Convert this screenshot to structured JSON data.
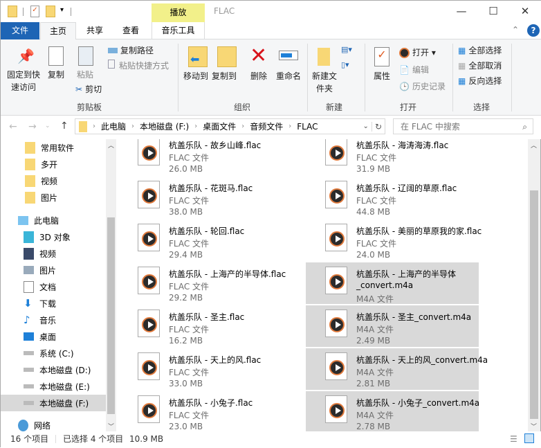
{
  "window": {
    "title": "FLAC",
    "context_tab": "播放",
    "minimize": "—",
    "maximize": "☐",
    "close": "✕"
  },
  "tabs": {
    "file": "文件",
    "home": "主页",
    "share": "共享",
    "view": "查看",
    "music_tools": "音乐工具"
  },
  "ribbon": {
    "pin": "固定到快速访问",
    "copy": "复制",
    "paste": "粘贴",
    "copy_path": "复制路径",
    "paste_shortcut": "粘贴快捷方式",
    "cut": "剪切",
    "clipboard_group": "剪贴板",
    "move_to": "移动到",
    "copy_to": "复制到",
    "delete": "删除",
    "rename": "重命名",
    "organize_group": "组织",
    "new_folder": "新建文件夹",
    "new_group": "新建",
    "properties": "属性",
    "open": "打开",
    "edit": "编辑",
    "history": "历史记录",
    "open_group": "打开",
    "select_all": "全部选择",
    "select_none": "全部取消",
    "invert": "反向选择",
    "select_group": "选择"
  },
  "address": {
    "crumbs": [
      "此电脑",
      "本地磁盘 (F:)",
      "桌面文件",
      "音频文件",
      "FLAC"
    ],
    "search_placeholder": "在 FLAC 中搜索"
  },
  "sidebar": {
    "items": [
      "常用软件",
      "多开",
      "视频",
      "图片",
      "此电脑",
      "3D 对象",
      "视频",
      "图片",
      "文档",
      "下载",
      "音乐",
      "桌面",
      "系统 (C:)",
      "本地磁盘 (D:)",
      "本地磁盘 (E:)",
      "本地磁盘 (F:)",
      "网络"
    ]
  },
  "files": [
    {
      "name": "杭盖乐队 - 故乡山峰.flac",
      "type": "FLAC 文件",
      "size": "26.0 MB",
      "selected": false
    },
    {
      "name": "杭盖乐队 - 海涛海涛.flac",
      "type": "FLAC 文件",
      "size": "31.9 MB",
      "selected": false
    },
    {
      "name": "杭盖乐队 - 花斑马.flac",
      "type": "FLAC 文件",
      "size": "38.0 MB",
      "selected": false
    },
    {
      "name": "杭盖乐队 - 辽阔的草原.flac",
      "type": "FLAC 文件",
      "size": "44.8 MB",
      "selected": false
    },
    {
      "name": "杭盖乐队 - 轮回.flac",
      "type": "FLAC 文件",
      "size": "29.4 MB",
      "selected": false
    },
    {
      "name": "杭盖乐队 - 美丽的草原我的家.flac",
      "type": "FLAC 文件",
      "size": "24.0 MB",
      "selected": false
    },
    {
      "name": "杭盖乐队 - 上海产的半导体.flac",
      "type": "FLAC 文件",
      "size": "29.2 MB",
      "selected": false
    },
    {
      "name": "杭盖乐队 - 上海产的半导体",
      "name2": "_convert.m4a",
      "type": "M4A 文件",
      "selected": true
    },
    {
      "name": "杭盖乐队 - 圣主.flac",
      "type": "FLAC 文件",
      "size": "16.2 MB",
      "selected": false
    },
    {
      "name": "杭盖乐队 - 圣主_convert.m4a",
      "type": "M4A 文件",
      "size": "2.49 MB",
      "selected": true
    },
    {
      "name": "杭盖乐队 - 天上的风.flac",
      "type": "FLAC 文件",
      "size": "33.0 MB",
      "selected": false
    },
    {
      "name": "杭盖乐队 - 天上的风_convert.m4a",
      "type": "M4A 文件",
      "size": "2.81 MB",
      "selected": true
    },
    {
      "name": "杭盖乐队 - 小兔子.flac",
      "type": "FLAC 文件",
      "size": "23.0 MB",
      "selected": false
    },
    {
      "name": "杭盖乐队 - 小兔子_convert.m4a",
      "type": "M4A 文件",
      "size": "2.78 MB",
      "selected": true
    }
  ],
  "status": {
    "count": "16 个项目",
    "selected": "已选择 4 个项目",
    "size": "10.9 MB"
  }
}
